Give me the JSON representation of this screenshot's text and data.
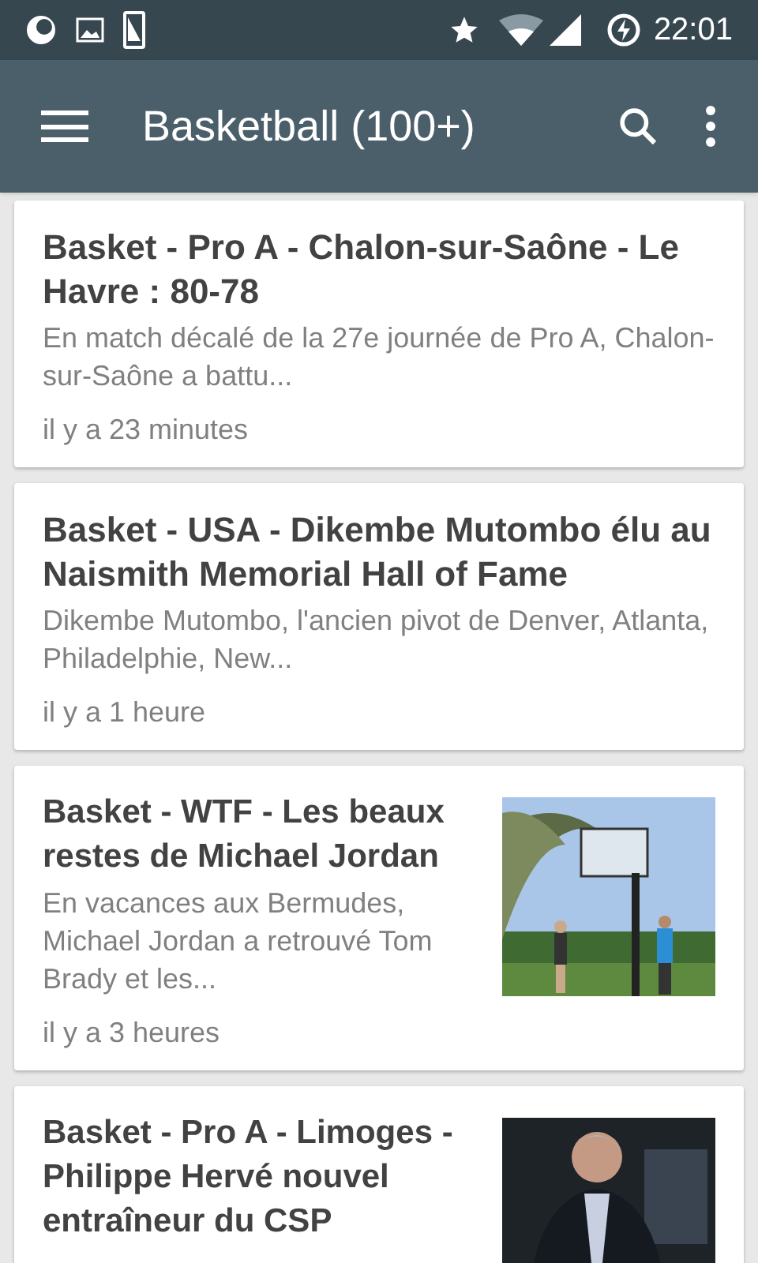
{
  "status_bar": {
    "time": "22:01"
  },
  "app_bar": {
    "title": "Basketball (100+)"
  },
  "articles": [
    {
      "title": "Basket - Pro A - Chalon-sur-Saône - Le Havre : 80-78",
      "snippet": "En match décalé de la 27e journée de Pro A, Chalon-sur-Saône a battu...",
      "time": "il y a 23 minutes"
    },
    {
      "title": "Basket - USA - Dikembe Mutombo élu au Naismith Memorial Hall of Fame",
      "snippet": "Dikembe Mutombo, l'ancien pivot de Denver, Atlanta, Philadelphie, New...",
      "time": "il y a 1 heure"
    },
    {
      "title": "Basket - WTF - Les beaux restes de Michael Jordan",
      "snippet": "En vacances aux Bermudes, Michael Jordan a retrouvé Tom Brady et les...",
      "time": "il y a 3 heures",
      "kind": "picture"
    },
    {
      "title": "Basket - Pro A - Limoges - Philippe Hervé nouvel entraîneur du CSP",
      "kind": "picture"
    }
  ]
}
